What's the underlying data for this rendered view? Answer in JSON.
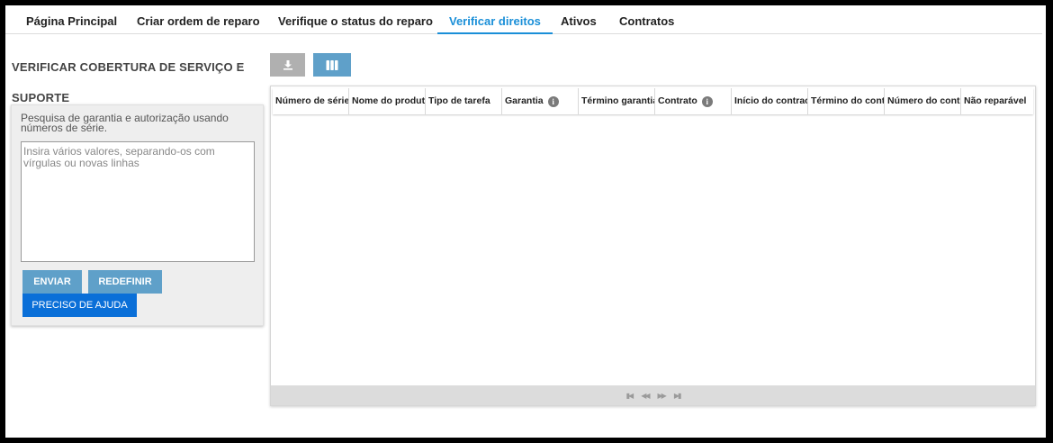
{
  "nav": {
    "tabs": [
      {
        "label": "Página Principal"
      },
      {
        "label": "Criar ordem de reparo"
      },
      {
        "label": "Verifique o status do reparo"
      },
      {
        "label": "Verificar direitos"
      },
      {
        "label": "Ativos"
      },
      {
        "label": "Contratos"
      }
    ],
    "active": "Verificar direitos"
  },
  "panel": {
    "title": "VERIFICAR COBERTURA DE SERVIÇO E SUPORTE",
    "description": "Pesquisa de garantia e autorização usando números de série.",
    "input_placeholder": "Insira vários valores, separando-os com vírgulas ou novas linhas",
    "input_value": "",
    "submit_label": "ENVIAR",
    "reset_label": "REDEFINIR",
    "help_label": "PRECISO DE AJUDA"
  },
  "toolbar": {
    "download_icon": "download-icon",
    "columns_icon": "columns-icon"
  },
  "grid": {
    "columns": [
      {
        "label": "Número de série",
        "info": false
      },
      {
        "label": "Nome do produto",
        "info": false
      },
      {
        "label": "Tipo de tarefa",
        "info": false
      },
      {
        "label": "Garantia",
        "info": true
      },
      {
        "label": "Término garantia",
        "info": false
      },
      {
        "label": "Contrato",
        "info": true
      },
      {
        "label": "Início do contract",
        "info": false
      },
      {
        "label": "Término do contra",
        "info": false
      },
      {
        "label": "Número do contra",
        "info": false
      },
      {
        "label": "Não reparável",
        "info": false
      }
    ],
    "rows": [],
    "pager": {
      "first": "first-page-icon",
      "prev": "prev-page-icon",
      "next": "next-page-icon",
      "last": "last-page-icon"
    }
  },
  "colors": {
    "accent": "#1a8fd8",
    "button": "#5fa0c9",
    "help_button": "#0a6fd8",
    "panel_bg": "#eeeeee"
  }
}
